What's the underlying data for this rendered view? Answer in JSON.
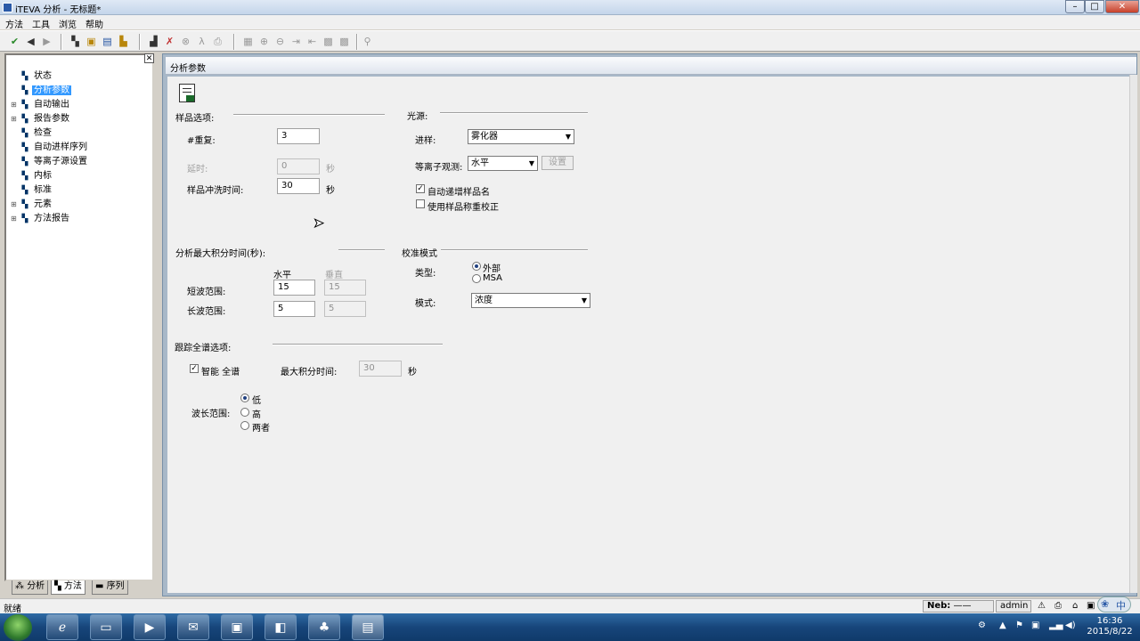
{
  "window": {
    "title": "iTEVA 分析 - 无标题*",
    "min": "–",
    "max": "□",
    "close": "✕"
  },
  "menu": [
    "方法",
    "工具",
    "浏览",
    "帮助"
  ],
  "toolbar_icons": [
    "save-icon",
    "back-icon",
    "forward-icon",
    "tree-icon",
    "open-icon",
    "export-icon",
    "lock-icon",
    "chart-icon",
    "stats-icon",
    "x-icon",
    "script-icon",
    "print-icon",
    "grid-icon",
    "zoom-in-icon",
    "zoom-out-icon",
    "fit-icon",
    "table-icon",
    "layout-icon",
    "search-icon"
  ],
  "tree": [
    {
      "label": "状态",
      "expandable": false,
      "selected": false
    },
    {
      "label": "分析参数",
      "expandable": false,
      "selected": true
    },
    {
      "label": "自动输出",
      "expandable": true,
      "selected": false
    },
    {
      "label": "报告参数",
      "expandable": true,
      "selected": false
    },
    {
      "label": "检查",
      "expandable": false,
      "selected": false
    },
    {
      "label": "自动进样序列",
      "expandable": false,
      "selected": false
    },
    {
      "label": "等离子源设置",
      "expandable": false,
      "selected": false
    },
    {
      "label": "内标",
      "expandable": false,
      "selected": false
    },
    {
      "label": "标准",
      "expandable": false,
      "selected": false
    },
    {
      "label": "元素",
      "expandable": true,
      "selected": false
    },
    {
      "label": "方法报告",
      "expandable": true,
      "selected": false
    }
  ],
  "bottom_tabs": {
    "analysis": "分析",
    "method": "方法",
    "sequence": "序列"
  },
  "header": {
    "title": "分析参数"
  },
  "sample": {
    "group": "样品选项:",
    "repeat_label": "#重复:",
    "repeat_value": "3",
    "delay_label": "延时:",
    "delay_value": "0",
    "delay_unit": "秒",
    "rinse_label": "样品冲洗时间:",
    "rinse_value": "30",
    "rinse_unit": "秒"
  },
  "source": {
    "group": "光源:",
    "injection_label": "进样:",
    "injection_value": "雾化器",
    "view_label": "等离子观测:",
    "view_value": "水平",
    "setup_button": "设置",
    "auto_increment_label": "自动递增样品名",
    "auto_increment_checked": true,
    "weight_correction_label": "使用样品称重校正",
    "weight_correction_checked": false
  },
  "integration": {
    "group": "分析最大积分时间(秒):",
    "col_horizontal": "水平",
    "col_vertical": "垂直",
    "short_label": "短波范围:",
    "short_h": "15",
    "short_v": "15",
    "long_label": "长波范围:",
    "long_h": "5",
    "long_v": "5"
  },
  "calibration": {
    "group": "校准模式",
    "type_label": "类型:",
    "type_external": "外部",
    "type_msa": "MSA",
    "type_selected": "外部",
    "mode_label": "模式:",
    "mode_value": "浓度"
  },
  "fullframe": {
    "group": "跟踪全谱选项:",
    "smart_label": "智能 全谱",
    "smart_checked": true,
    "max_time_label": "最大积分时间:",
    "max_time_value": "30",
    "max_time_unit": "秒",
    "range_label": "波长范围:",
    "range_low": "低",
    "range_high": "高",
    "range_both": "两者",
    "range_selected": "低"
  },
  "status": {
    "text": "就绪",
    "neb_label": "Neb:",
    "neb_value": "——",
    "user": "admin"
  },
  "taskbar": {
    "apps": [
      "ie-icon",
      "explorer-icon",
      "media-icon",
      "outlook-icon",
      "app-icon",
      "office-icon",
      "iteva-icon",
      "iteva-method-icon"
    ]
  },
  "tray": {
    "ime": "中",
    "time": "16:36",
    "date": "2015/8/22"
  }
}
